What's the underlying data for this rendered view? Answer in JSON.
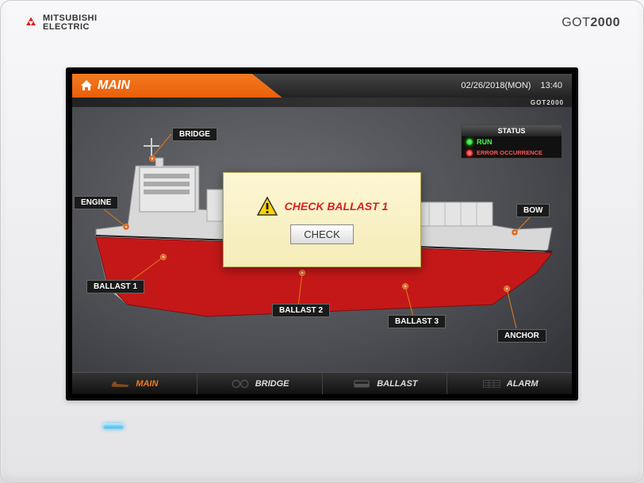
{
  "brand": {
    "name_line1": "MITSUBISHI",
    "name_line2": "ELECTRIC",
    "product_prefix": "GOT",
    "product_model": "2000"
  },
  "header": {
    "home_icon": "home-icon",
    "title": "MAIN",
    "date": "02/26/2018(MON)",
    "time": "13:40",
    "sub_brand": "GOT2000"
  },
  "status": {
    "title": "STATUS",
    "run": "RUN",
    "error": "ERROR OCCURRENCE"
  },
  "ship_labels": {
    "bridge": "BRIDGE",
    "engine": "ENGINE",
    "bow": "BOW",
    "ballast1": "BALLAST 1",
    "ballast2": "BALLAST 2",
    "ballast3": "BALLAST 3",
    "anchor": "ANCHOR"
  },
  "popup": {
    "message": "CHECK BALLAST 1",
    "button": "CHECK"
  },
  "nav": {
    "main": "MAIN",
    "bridge": "BRIDGE",
    "ballast": "BALLAST",
    "alarm": "ALARM"
  }
}
